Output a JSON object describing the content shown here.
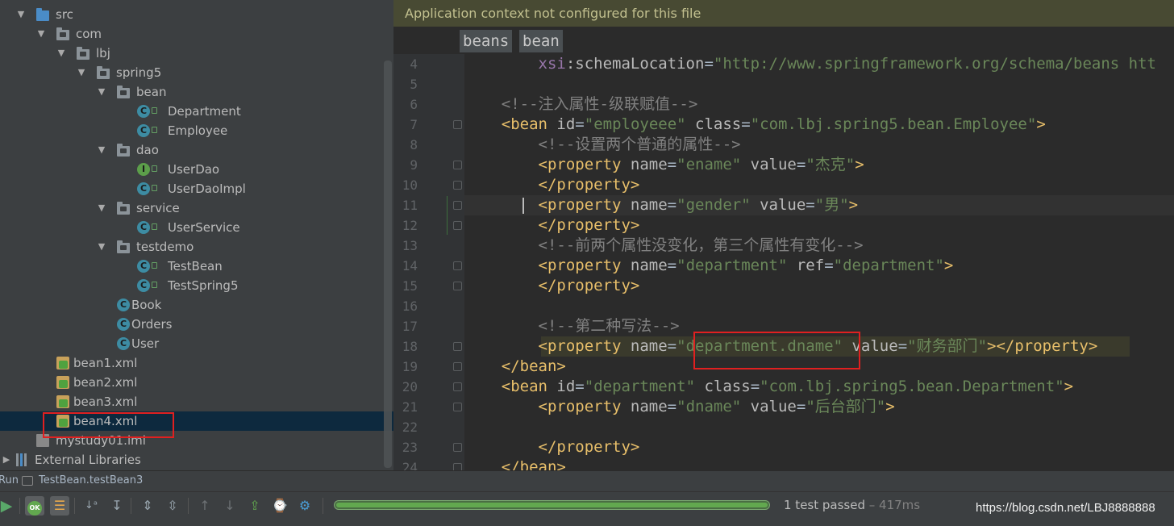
{
  "project_tree": {
    "items": [
      {
        "label": "src",
        "icon": "source-folder-icon",
        "indent": 0,
        "expanded": true
      },
      {
        "label": "com",
        "icon": "package-icon",
        "indent": 1,
        "expanded": true
      },
      {
        "label": "lbj",
        "icon": "package-icon",
        "indent": 2,
        "expanded": true
      },
      {
        "label": "spring5",
        "icon": "package-icon",
        "indent": 3,
        "expanded": true
      },
      {
        "label": "bean",
        "icon": "package-icon",
        "indent": 4,
        "expanded": true
      },
      {
        "label": "Department",
        "icon": "class-icon",
        "indent": 5
      },
      {
        "label": "Employee",
        "icon": "class-icon",
        "indent": 5
      },
      {
        "label": "dao",
        "icon": "package-icon",
        "indent": 4,
        "expanded": true
      },
      {
        "label": "UserDao",
        "icon": "interface-icon",
        "indent": 5
      },
      {
        "label": "UserDaoImpl",
        "icon": "class-icon",
        "indent": 5
      },
      {
        "label": "service",
        "icon": "package-icon",
        "indent": 4,
        "expanded": true
      },
      {
        "label": "UserService",
        "icon": "class-icon",
        "indent": 5
      },
      {
        "label": "testdemo",
        "icon": "package-icon",
        "indent": 4,
        "expanded": true
      },
      {
        "label": "TestBean",
        "icon": "test-class-icon",
        "indent": 5
      },
      {
        "label": "TestSpring5",
        "icon": "test-class-icon",
        "indent": 5
      },
      {
        "label": "Book",
        "icon": "class-icon",
        "indent": 4
      },
      {
        "label": "Orders",
        "icon": "class-icon",
        "indent": 4
      },
      {
        "label": "User",
        "icon": "class-icon",
        "indent": 4
      },
      {
        "label": "bean1.xml",
        "icon": "xml-file-icon",
        "indent": 1
      },
      {
        "label": "bean2.xml",
        "icon": "xml-file-icon",
        "indent": 1
      },
      {
        "label": "bean3.xml",
        "icon": "xml-file-icon",
        "indent": 1
      },
      {
        "label": "bean4.xml",
        "icon": "xml-file-icon",
        "indent": 1,
        "selected": true
      },
      {
        "label": "mystudy01.iml",
        "icon": "iml-file-icon",
        "indent": 0
      },
      {
        "label": "External Libraries",
        "icon": "library-icon",
        "indent": 0
      }
    ]
  },
  "editor": {
    "notification": "Application context not configured for this file",
    "breadcrumbs": [
      "beans",
      "bean"
    ],
    "lines": [
      {
        "num": "4",
        "segments": [
          {
            "t": "        ",
            "c": ""
          },
          {
            "t": "xsi",
            "c": "ns"
          },
          {
            "t": ":schemaLocation",
            "c": "attr"
          },
          {
            "t": "=",
            "c": ""
          },
          {
            "t": "\"http://www.springframework.org/schema/beans htt",
            "c": "val"
          }
        ]
      },
      {
        "num": "5",
        "segments": []
      },
      {
        "num": "6",
        "segments": [
          {
            "t": "    ",
            "c": ""
          },
          {
            "t": "<!--注入属性-级联赋值-->",
            "c": "cmt"
          }
        ]
      },
      {
        "num": "7",
        "segments": [
          {
            "t": "    ",
            "c": ""
          },
          {
            "t": "<bean ",
            "c": "tag"
          },
          {
            "t": "id",
            "c": "attr"
          },
          {
            "t": "=",
            "c": ""
          },
          {
            "t": "\"employeee\"",
            "c": "val"
          },
          {
            "t": " ",
            "c": ""
          },
          {
            "t": "class",
            "c": "attr"
          },
          {
            "t": "=",
            "c": ""
          },
          {
            "t": "\"com.lbj.spring5.bean.Employee\"",
            "c": "val"
          },
          {
            "t": ">",
            "c": "tag"
          }
        ]
      },
      {
        "num": "8",
        "segments": [
          {
            "t": "        ",
            "c": ""
          },
          {
            "t": "<!--设置两个普通的属性-->",
            "c": "cmt"
          }
        ]
      },
      {
        "num": "9",
        "segments": [
          {
            "t": "        ",
            "c": ""
          },
          {
            "t": "<property ",
            "c": "tag"
          },
          {
            "t": "name",
            "c": "attr"
          },
          {
            "t": "=",
            "c": ""
          },
          {
            "t": "\"ename\"",
            "c": "val"
          },
          {
            "t": " ",
            "c": ""
          },
          {
            "t": "value",
            "c": "attr"
          },
          {
            "t": "=",
            "c": ""
          },
          {
            "t": "\"杰克\"",
            "c": "val"
          },
          {
            "t": ">",
            "c": "tag"
          }
        ]
      },
      {
        "num": "10",
        "segments": [
          {
            "t": "        ",
            "c": ""
          },
          {
            "t": "</property>",
            "c": "tag"
          }
        ]
      },
      {
        "num": "11",
        "segments": [
          {
            "t": "        ",
            "c": ""
          },
          {
            "t": "<property ",
            "c": "tag"
          },
          {
            "t": "name",
            "c": "attr"
          },
          {
            "t": "=",
            "c": ""
          },
          {
            "t": "\"gender\"",
            "c": "val"
          },
          {
            "t": " ",
            "c": ""
          },
          {
            "t": "value",
            "c": "attr"
          },
          {
            "t": "=",
            "c": ""
          },
          {
            "t": "\"男\"",
            "c": "val"
          },
          {
            "t": ">",
            "c": "tag"
          }
        ]
      },
      {
        "num": "12",
        "segments": [
          {
            "t": "        ",
            "c": ""
          },
          {
            "t": "</property>",
            "c": "tag"
          }
        ]
      },
      {
        "num": "13",
        "segments": [
          {
            "t": "        ",
            "c": ""
          },
          {
            "t": "<!--前两个属性没变化，第三个属性有变化-->",
            "c": "cmt"
          }
        ]
      },
      {
        "num": "14",
        "segments": [
          {
            "t": "        ",
            "c": ""
          },
          {
            "t": "<property ",
            "c": "tag"
          },
          {
            "t": "name",
            "c": "attr"
          },
          {
            "t": "=",
            "c": ""
          },
          {
            "t": "\"department\"",
            "c": "val"
          },
          {
            "t": " ",
            "c": ""
          },
          {
            "t": "ref",
            "c": "attr"
          },
          {
            "t": "=",
            "c": ""
          },
          {
            "t": "\"department\"",
            "c": "val"
          },
          {
            "t": ">",
            "c": "tag"
          }
        ]
      },
      {
        "num": "15",
        "segments": [
          {
            "t": "        ",
            "c": ""
          },
          {
            "t": "</property>",
            "c": "tag"
          }
        ]
      },
      {
        "num": "16",
        "segments": []
      },
      {
        "num": "17",
        "segments": [
          {
            "t": "        ",
            "c": ""
          },
          {
            "t": "<!--第二种写法-->",
            "c": "cmt"
          }
        ]
      },
      {
        "num": "18",
        "hl": true,
        "segments": [
          {
            "t": "        ",
            "c": ""
          },
          {
            "t": "<property ",
            "c": "tag"
          },
          {
            "t": "name",
            "c": "attr"
          },
          {
            "t": "=",
            "c": ""
          },
          {
            "t": "\"department.dname\"",
            "c": "val"
          },
          {
            "t": " ",
            "c": ""
          },
          {
            "t": "value",
            "c": "attr"
          },
          {
            "t": "=",
            "c": ""
          },
          {
            "t": "\"财务部门\"",
            "c": "val"
          },
          {
            "t": "></property>",
            "c": "tag"
          }
        ]
      },
      {
        "num": "19",
        "segments": [
          {
            "t": "    ",
            "c": ""
          },
          {
            "t": "</bean>",
            "c": "tag"
          }
        ]
      },
      {
        "num": "20",
        "segments": [
          {
            "t": "    ",
            "c": ""
          },
          {
            "t": "<bean ",
            "c": "tag"
          },
          {
            "t": "id",
            "c": "attr"
          },
          {
            "t": "=",
            "c": ""
          },
          {
            "t": "\"department\"",
            "c": "val"
          },
          {
            "t": " ",
            "c": ""
          },
          {
            "t": "class",
            "c": "attr"
          },
          {
            "t": "=",
            "c": ""
          },
          {
            "t": "\"com.lbj.spring5.bean.Department\"",
            "c": "val"
          },
          {
            "t": ">",
            "c": "tag"
          }
        ]
      },
      {
        "num": "21",
        "segments": [
          {
            "t": "        ",
            "c": ""
          },
          {
            "t": "<property ",
            "c": "tag"
          },
          {
            "t": "name",
            "c": "attr"
          },
          {
            "t": "=",
            "c": ""
          },
          {
            "t": "\"dname\"",
            "c": "val"
          },
          {
            "t": " ",
            "c": ""
          },
          {
            "t": "value",
            "c": "attr"
          },
          {
            "t": "=",
            "c": ""
          },
          {
            "t": "\"后台部门\"",
            "c": "val"
          },
          {
            "t": ">",
            "c": "tag"
          }
        ]
      },
      {
        "num": "22",
        "segments": []
      },
      {
        "num": "23",
        "segments": [
          {
            "t": "        ",
            "c": ""
          },
          {
            "t": "</property>",
            "c": "tag"
          }
        ]
      },
      {
        "num": "24",
        "segments": [
          {
            "t": "    ",
            "c": ""
          },
          {
            "t": "</bean>",
            "c": "tag"
          }
        ]
      }
    ]
  },
  "run_panel": {
    "label": "Run",
    "config": "TestBean.testBean3",
    "progress": 1.0,
    "status": "1 test passed",
    "duration": " – 417ms",
    "toolbar_icons": [
      "run-icon",
      "ok-filter-icon",
      "ignored-filter-icon",
      "sort-alpha-icon",
      "sort-duration-icon",
      "expand-all-icon",
      "collapse-all-icon",
      "previous-failed-icon",
      "next-failed-icon",
      "export-icon",
      "import-history-icon",
      "settings-icon"
    ]
  },
  "watermark": "https://blog.csdn.net/LBJ8888888",
  "colors": {
    "tag": "#e8bf6a",
    "attr": "#bababa",
    "value": "#6a8759",
    "comment": "#808080",
    "highlight_box": "#e02020",
    "progress": "#62a84f"
  }
}
